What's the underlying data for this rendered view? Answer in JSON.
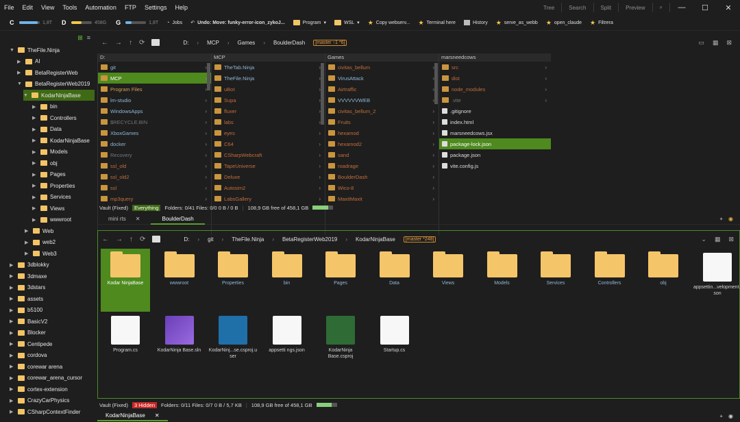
{
  "menu": [
    "File",
    "Edit",
    "View",
    "Tools",
    "Automation",
    "FTP",
    "Settings",
    "Help"
  ],
  "topright": [
    "Tree",
    "Search",
    "Split",
    "Preview"
  ],
  "window": {
    "minimize": "—",
    "maximize": "☐",
    "close": "✕"
  },
  "drives": [
    {
      "letter": "C",
      "size": "1,8T",
      "fill": 0.9,
      "color": "#6fb4e8"
    },
    {
      "letter": "D",
      "size": "458G",
      "fill": 0.5,
      "color": "#f3c74c"
    },
    {
      "letter": "G",
      "size": "1,8T",
      "fill": 0.3,
      "color": "#6fb4e8"
    }
  ],
  "toolbar": {
    "jobs": "Jobs",
    "undo": "Undo: Move: funky-error-icon_zykoJ...",
    "program": "Program",
    "wsl": "WSL",
    "copy": "Copy webserv...",
    "terminal": "Terminal here",
    "history": "History",
    "serve": "serve_as_webb",
    "open_claude": "open_claude",
    "filtrera": "Filtrera"
  },
  "tree": [
    {
      "label": "TheFile.Ninja",
      "depth": 0,
      "open": true
    },
    {
      "label": "AI",
      "depth": 1
    },
    {
      "label": "BetaRegisterWeb",
      "depth": 1
    },
    {
      "label": "BetaRegisterWeb2019",
      "depth": 1,
      "open": true
    },
    {
      "label": "KodarNinjaBase",
      "depth": 2,
      "open": true,
      "sel": true
    },
    {
      "label": "bin",
      "depth": 3
    },
    {
      "label": "Controllers",
      "depth": 3
    },
    {
      "label": "Data",
      "depth": 3
    },
    {
      "label": "KodarNinjaBase",
      "depth": 3
    },
    {
      "label": "Models",
      "depth": 3
    },
    {
      "label": "obj",
      "depth": 3
    },
    {
      "label": "Pages",
      "depth": 3
    },
    {
      "label": "Properties",
      "depth": 3
    },
    {
      "label": "Services",
      "depth": 3
    },
    {
      "label": "Views",
      "depth": 3
    },
    {
      "label": "wwwroot",
      "depth": 3
    },
    {
      "label": "Web",
      "depth": 2
    },
    {
      "label": "web2",
      "depth": 2
    },
    {
      "label": "Web3",
      "depth": 2
    },
    {
      "label": "3dblokky",
      "depth": 0
    },
    {
      "label": "3dmaxe",
      "depth": 0
    },
    {
      "label": "3dstars",
      "depth": 0
    },
    {
      "label": "assets",
      "depth": 0
    },
    {
      "label": "b5100",
      "depth": 0
    },
    {
      "label": "BasicV2",
      "depth": 0
    },
    {
      "label": "Blocker",
      "depth": 0
    },
    {
      "label": "Centipede",
      "depth": 0
    },
    {
      "label": "cordova",
      "depth": 0
    },
    {
      "label": "corewar arena",
      "depth": 0
    },
    {
      "label": "corewar_arena_cursor",
      "depth": 0
    },
    {
      "label": "cortex-extension",
      "depth": 0
    },
    {
      "label": "CrazyCarPhysics",
      "depth": 0
    },
    {
      "label": "CSharpContextFinder",
      "depth": 0
    }
  ],
  "top": {
    "crumbs": [
      "D:",
      "MCP",
      "Games",
      "BoulderDash"
    ],
    "branch": "[master ↑1 *6]",
    "columns": [
      {
        "head": "D:",
        "rows": [
          [
            "git",
            "#8fb8d8"
          ],
          [
            "MCP",
            "#fff"
          ],
          [
            "Program Files",
            "#d4a050"
          ],
          [
            "lm-studio",
            "#8fb8d8"
          ],
          [
            "WindowsApps",
            "#8fb8d8"
          ],
          [
            "$RECYCLE.BIN",
            "#777"
          ],
          [
            "XboxGames",
            "#8fb8d8"
          ],
          [
            "docker",
            "#8fb8d8"
          ],
          [
            "Recovery",
            "#777"
          ],
          [
            "ssl_old",
            "#c46e3a"
          ],
          [
            "ssl_old2",
            "#c46e3a"
          ],
          [
            "ssl",
            "#c46e3a"
          ],
          [
            "mp3query",
            "#c46e3a"
          ]
        ],
        "sel": 1
      },
      {
        "head": "MCP",
        "rows": [
          [
            "TheTab.Ninja",
            "#8fb8d8"
          ],
          [
            "TheFile.Ninja",
            "#8fb8d8"
          ],
          [
            "uBot",
            "#c46e3a"
          ],
          [
            "Supa",
            "#c46e3a"
          ],
          [
            "fluxer",
            "#c46e3a"
          ],
          [
            "labs",
            "#c46e3a"
          ],
          [
            "eyes",
            "#c46e3a"
          ],
          [
            "C64",
            "#c46e3a"
          ],
          [
            "CSharpWebcraft",
            "#c46e3a"
          ],
          [
            "TapeUniverse",
            "#c46e3a"
          ],
          [
            "Deluxe",
            "#c46e3a"
          ],
          [
            "Autosim2",
            "#c46e3a"
          ],
          [
            "LabsGallery",
            "#c46e3a"
          ]
        ],
        "sel": -1
      },
      {
        "head": "Games",
        "rows": [
          [
            "civitas_bellum",
            "#c46e3a"
          ],
          [
            "VirusAttack",
            "#8fb8d8"
          ],
          [
            "Airtraffic",
            "#c46e3a"
          ],
          [
            "VVVVVVWEB",
            "#8fb8d8"
          ],
          [
            "civitas_bellum_2",
            "#c46e3a"
          ],
          [
            "Fruits",
            "#c46e3a"
          ],
          [
            "hexamod",
            "#c46e3a"
          ],
          [
            "hexamod2",
            "#c46e3a"
          ],
          [
            "sand",
            "#c46e3a"
          ],
          [
            "roadrage",
            "#c46e3a"
          ],
          [
            "BoulderDash",
            "#c46e3a"
          ],
          [
            "Wico-8",
            "#c46e3a"
          ],
          [
            "MaxitMaxit",
            "#c46e3a"
          ]
        ],
        "sel": -1
      },
      {
        "head": "marsneedcows",
        "rows": [
          [
            "src",
            "#c46e3a"
          ],
          [
            "dist",
            "#c46e3a"
          ],
          [
            "node_modules",
            "#c46e3a"
          ],
          [
            ".vite",
            "#777"
          ],
          [
            ".gitignore",
            "#ddd"
          ],
          [
            "index.html",
            "#ddd"
          ],
          [
            "marsneedcows.jsx",
            "#ddd"
          ],
          [
            "package-lock.json",
            "#fff"
          ],
          [
            "package.json",
            "#ddd"
          ],
          [
            "vite.config.js",
            "#ddd"
          ]
        ],
        "sel": 7
      }
    ],
    "status": {
      "vault": "Vault (Fixed)",
      "mode": "Everything",
      "folders": "Folders: 0/41 Files: 0/0 0 B / 0 B",
      "free": "108,9 GB free of 458,1 GB",
      "fill": 0.76
    },
    "tabs": [
      "mini rts",
      "BoulderDash"
    ]
  },
  "bottom": {
    "crumbs": [
      "D:",
      "git",
      "TheFile.Ninja",
      "BetaRegisterWeb2019",
      "KodarNinjaBase"
    ],
    "branch": "[master *248]",
    "folders": [
      "Kodar NinjaBase",
      "wwwroot",
      "Properties",
      "bin",
      "Pages",
      "Data",
      "Views",
      "Models",
      "Services",
      "Controllers",
      "obj"
    ],
    "file_appsettings_dev": "appsettin...velopment.json",
    "files": [
      "Program.cs",
      "KodarNinja Base.sln",
      "KodarNinj...se.csproj.user",
      "appsetti ngs.json",
      "KodarNinja Base.csproj",
      "Startup.cs"
    ],
    "status": {
      "vault": "Vault (Fixed)",
      "hidden": "3 Hidden",
      "folders": "Folders: 0/11 Files: 0/7 0 B / 5,7 KB",
      "free": "108,9 GB free of 458,1 GB",
      "fill": 0.76
    },
    "tabs": [
      "KodarNinjaBase"
    ]
  }
}
